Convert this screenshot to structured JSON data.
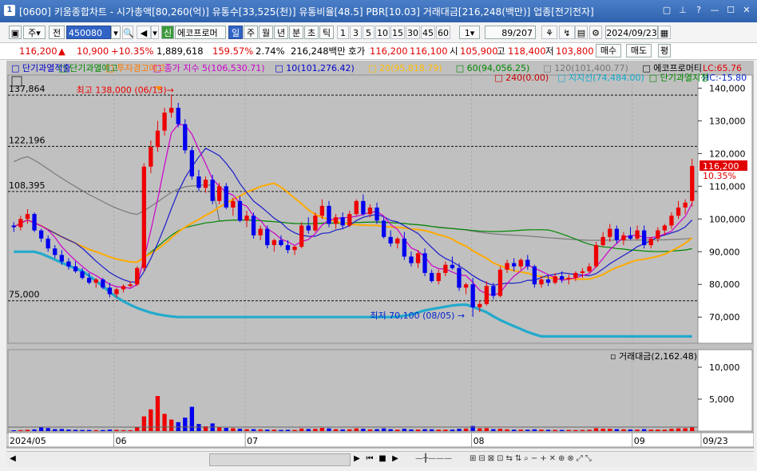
{
  "window": {
    "icon_label": "1",
    "title": "[0600] 키움종합차트 - 시가총액[80,260(억)] 유통수[33,525(천)] 유통비율[48.5] PBR[10.03] 거래대금[216,248(백만)] 업종[전기전자]"
  },
  "toolbar": {
    "period_select": "주",
    "mode_select": "전",
    "stock_code": "450080",
    "new_badge": "신",
    "stock_name": "에코프로머",
    "timeframes": [
      "일",
      "주",
      "월",
      "년",
      "분",
      "초",
      "틱"
    ],
    "active_timeframe": "일",
    "intervals": [
      "1",
      "3",
      "5",
      "10",
      "15",
      "30",
      "45",
      "60"
    ],
    "interval_select": "1",
    "page_counter": "89/207",
    "date": "2024/09/23"
  },
  "quote": {
    "price": "116,200",
    "change": "10,900",
    "change_pct": "+10.35%",
    "volume": "1,889,618",
    "vol_ratio": "159.57%",
    "turnover_rate": "2.74%",
    "turnover_amount": "216,248백만",
    "bid_ask_label": "호가",
    "ask": "116,200",
    "bid": "116,100",
    "open_label": "시",
    "open": "105,900",
    "high_label": "고",
    "high": "118,400",
    "low_label": "저",
    "low": "103,800",
    "buy_label": "매수",
    "sell_label": "매도",
    "avg_label": "평"
  },
  "legend": {
    "row1": [
      {
        "text": "단기과열적출",
        "color": "#0000cc"
      },
      {
        "text": "단기과열예고",
        "color": "#008800"
      },
      {
        "text": "투자경고예고",
        "color": "#ff7700"
      },
      {
        "text": "종가 지수 5(106,530.71)",
        "color": "#cc00cc"
      },
      {
        "text": "10(101,276.42)",
        "color": "#0000cc"
      },
      {
        "text": "20(95,818.79)",
        "color": "#ffbb00"
      },
      {
        "text": "60(94,056.25)",
        "color": "#008800"
      },
      {
        "text": "120(101,400.77)",
        "color": "#777777"
      },
      {
        "text": "에코프로머티",
        "color": "#000000"
      }
    ],
    "row2": [
      {
        "text": "240(0.00)",
        "color": "#cc0000"
      },
      {
        "text": "지지선(74,484.00)",
        "color": "#11aacc"
      },
      {
        "text": "단기과열지정",
        "color": "#008800"
      }
    ],
    "lc": "LC:65.76",
    "hc": "HC:-15.80"
  },
  "chart_data": {
    "type": "candlestick",
    "price_axis_ticks": [
      "140,000",
      "130,000",
      "120,000",
      "110,000",
      "100,000",
      "90,000",
      "80,000",
      "70,000"
    ],
    "volume_axis_ticks": [
      "10,000",
      "5,000"
    ],
    "ylim": [
      62000,
      144000
    ],
    "reference_levels": [
      {
        "label": "137,864",
        "value": 137864
      },
      {
        "label": "122,196",
        "value": 122196
      },
      {
        "label": "108,395",
        "value": 108395
      },
      {
        "label": "75,000",
        "value": 75000
      }
    ],
    "annotations": {
      "high": "최고 138,000 (06/13)",
      "low": "최저 70,100 (08/05)",
      "current_price": "116,200",
      "current_pct": "10.35%"
    },
    "volume_title": "거래대금(2,162.48)",
    "x_labels": [
      "2024/05",
      "06",
      "07",
      "08",
      "09",
      "09/23"
    ],
    "month_dividers": [
      29,
      65,
      127,
      171
    ],
    "num_bars": 189,
    "candles": [
      [
        98000,
        99000,
        96000,
        97500,
        120
      ],
      [
        97500,
        101000,
        96500,
        100000,
        150
      ],
      [
        100000,
        103000,
        98500,
        101500,
        200
      ],
      [
        101500,
        102000,
        96000,
        96500,
        260
      ],
      [
        96500,
        97000,
        93000,
        94000,
        620
      ],
      [
        94000,
        95000,
        90000,
        91000,
        480
      ],
      [
        91000,
        92000,
        88000,
        89000,
        300
      ],
      [
        89000,
        90500,
        86000,
        87000,
        320
      ],
      [
        87000,
        88000,
        84500,
        85500,
        240
      ],
      [
        85500,
        87000,
        83500,
        84000,
        200
      ],
      [
        84000,
        85000,
        81500,
        82000,
        180
      ],
      [
        82000,
        83500,
        80000,
        80500,
        170
      ],
      [
        80500,
        82000,
        79000,
        81500,
        150
      ],
      [
        81500,
        82000,
        78500,
        79000,
        160
      ],
      [
        79000,
        80500,
        76000,
        77000,
        240
      ],
      [
        77000,
        79000,
        76000,
        78500,
        200
      ],
      [
        78500,
        80000,
        77500,
        79500,
        150
      ],
      [
        79500,
        81000,
        79000,
        80000,
        140
      ],
      [
        80000,
        85500,
        79500,
        85000,
        620
      ],
      [
        85000,
        117000,
        84000,
        116000,
        2300
      ],
      [
        116000,
        124000,
        114000,
        122000,
        3400
      ],
      [
        122000,
        130000,
        120500,
        127000,
        5500
      ],
      [
        127000,
        134000,
        125500,
        132500,
        2700
      ],
      [
        132500,
        138000,
        131000,
        134000,
        1800
      ],
      [
        134000,
        135500,
        128000,
        129000,
        1400
      ],
      [
        129000,
        130500,
        120000,
        121000,
        2100
      ],
      [
        121000,
        122000,
        112000,
        113000,
        3800
      ],
      [
        113000,
        115000,
        108500,
        109500,
        1100
      ],
      [
        109500,
        113000,
        108000,
        112000,
        750
      ],
      [
        112000,
        113500,
        104500,
        105500,
        1200
      ],
      [
        105500,
        111000,
        104500,
        110000,
        600
      ],
      [
        110000,
        111000,
        103000,
        103500,
        500
      ],
      [
        103500,
        106500,
        101000,
        105500,
        450
      ],
      [
        105500,
        107000,
        99000,
        99500,
        380
      ],
      [
        99500,
        102500,
        97500,
        101000,
        300
      ],
      [
        101000,
        102000,
        94000,
        95000,
        300
      ],
      [
        95000,
        98000,
        93500,
        97000,
        260
      ],
      [
        97000,
        98000,
        91000,
        92000,
        240
      ],
      [
        92000,
        94000,
        90000,
        93500,
        220
      ],
      [
        93500,
        95000,
        91500,
        92000,
        180
      ],
      [
        92000,
        93500,
        89500,
        90500,
        200
      ],
      [
        90500,
        92000,
        89000,
        91500,
        170
      ],
      [
        91500,
        99000,
        91000,
        98000,
        400
      ],
      [
        98000,
        100500,
        95500,
        96500,
        320
      ],
      [
        96500,
        102000,
        96000,
        101000,
        350
      ],
      [
        101000,
        106000,
        100000,
        104000,
        500
      ],
      [
        104000,
        105500,
        97500,
        98500,
        420
      ],
      [
        98500,
        101500,
        97000,
        100500,
        300
      ],
      [
        100500,
        102000,
        97000,
        98000,
        260
      ],
      [
        98000,
        102500,
        97500,
        101500,
        270
      ],
      [
        101500,
        106000,
        101000,
        105500,
        420
      ],
      [
        105500,
        107500,
        101000,
        101500,
        360
      ],
      [
        101500,
        104500,
        100500,
        103500,
        260
      ],
      [
        103500,
        105000,
        98500,
        99500,
        300
      ],
      [
        99500,
        100500,
        94000,
        94500,
        420
      ],
      [
        94500,
        96500,
        91500,
        92500,
        300
      ],
      [
        92500,
        94500,
        91000,
        94000,
        220
      ],
      [
        94000,
        96000,
        87500,
        88500,
        360
      ],
      [
        88500,
        90000,
        85500,
        86500,
        260
      ],
      [
        86500,
        90500,
        85000,
        89500,
        240
      ],
      [
        89500,
        91000,
        82500,
        83500,
        300
      ],
      [
        83500,
        84500,
        80500,
        81000,
        280
      ],
      [
        81000,
        84500,
        80000,
        83500,
        220
      ],
      [
        83500,
        87000,
        82500,
        86000,
        220
      ],
      [
        86000,
        88500,
        84500,
        85000,
        240
      ],
      [
        85000,
        86500,
        78000,
        79000,
        350
      ],
      [
        79000,
        80500,
        77000,
        80000,
        400
      ],
      [
        80000,
        82000,
        70100,
        73000,
        800
      ],
      [
        73000,
        75000,
        71500,
        74000,
        420
      ],
      [
        74000,
        81000,
        73500,
        79500,
        460
      ],
      [
        79500,
        80500,
        75500,
        76500,
        300
      ],
      [
        76500,
        85500,
        76000,
        84500,
        380
      ],
      [
        84500,
        87500,
        83500,
        86500,
        280
      ],
      [
        86500,
        88000,
        84000,
        85500,
        230
      ],
      [
        85500,
        88000,
        84500,
        87500,
        220
      ],
      [
        87500,
        89000,
        84500,
        85500,
        210
      ],
      [
        85500,
        86000,
        79000,
        80000,
        280
      ],
      [
        80000,
        82500,
        79000,
        81500,
        230
      ],
      [
        81500,
        83000,
        79500,
        80500,
        200
      ],
      [
        80500,
        83500,
        80000,
        82500,
        190
      ],
      [
        82500,
        84000,
        80500,
        81500,
        180
      ],
      [
        81500,
        83000,
        80000,
        82000,
        170
      ],
      [
        82000,
        84000,
        81000,
        83500,
        160
      ],
      [
        83500,
        85000,
        82000,
        84000,
        170
      ],
      [
        84000,
        86500,
        83500,
        85500,
        200
      ],
      [
        85500,
        93000,
        85000,
        92000,
        450
      ],
      [
        92000,
        96000,
        91500,
        94500,
        380
      ],
      [
        94500,
        98500,
        93000,
        97000,
        360
      ],
      [
        97000,
        98000,
        92500,
        93500,
        300
      ],
      [
        93500,
        96000,
        92000,
        95000,
        280
      ],
      [
        95000,
        97500,
        93500,
        94000,
        250
      ],
      [
        94000,
        98000,
        93500,
        96500,
        240
      ],
      [
        96500,
        98000,
        91000,
        92000,
        300
      ],
      [
        92000,
        94500,
        91000,
        94000,
        230
      ],
      [
        94000,
        97500,
        93000,
        96500,
        240
      ],
      [
        96500,
        98500,
        95000,
        98000,
        230
      ],
      [
        98000,
        102000,
        97000,
        101000,
        350
      ],
      [
        101000,
        105500,
        100000,
        103500,
        420
      ],
      [
        103500,
        106000,
        101500,
        105000,
        450
      ],
      [
        105500,
        118400,
        103800,
        116200,
        650
      ]
    ]
  },
  "scroll": {
    "left_arrow": "◀",
    "right_arrow": "▶"
  }
}
